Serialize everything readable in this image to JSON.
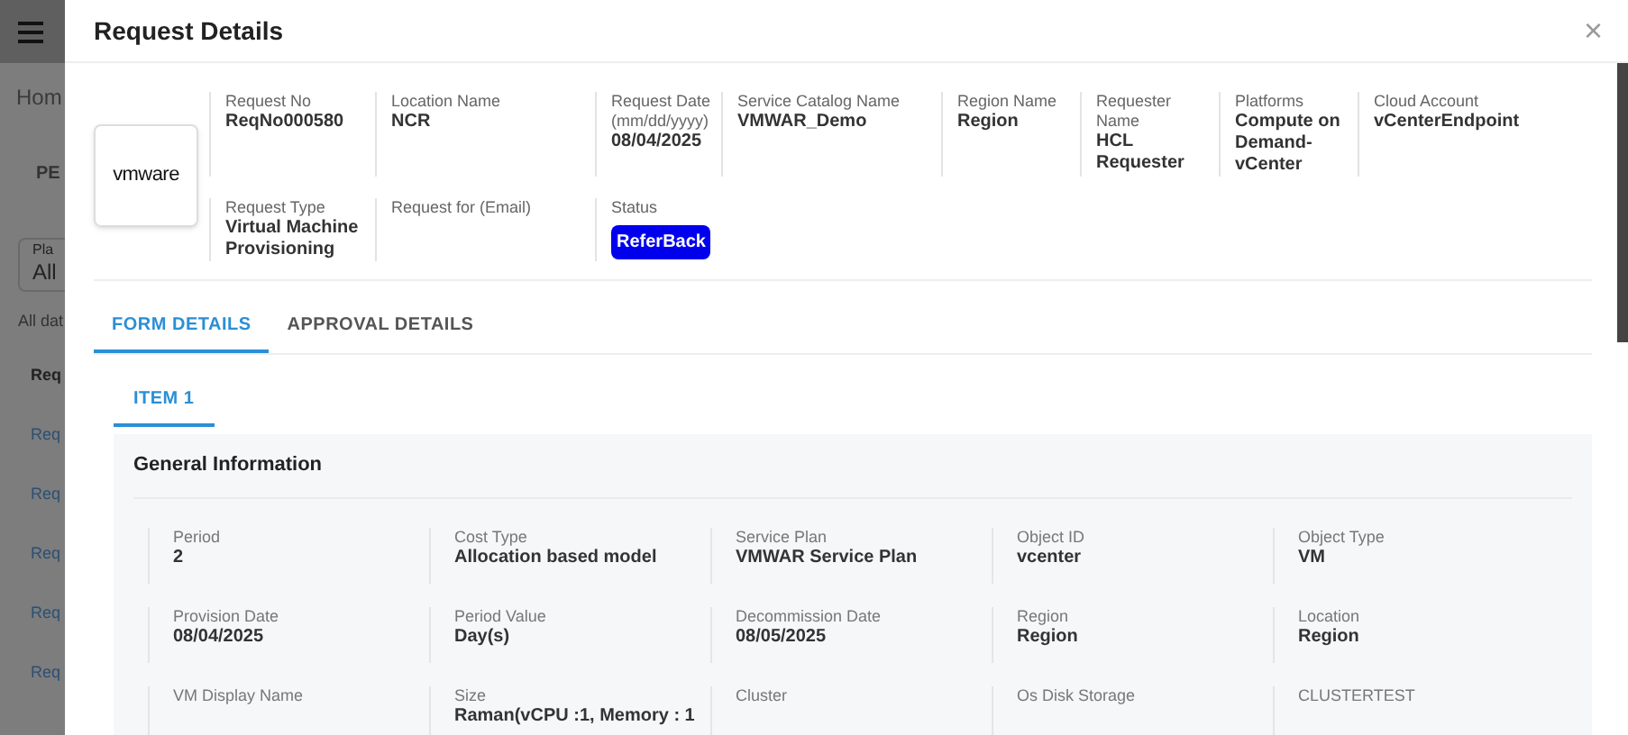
{
  "background": {
    "breadcrumb": "Hom",
    "tab": "PE",
    "filter": {
      "label": "Pla",
      "value": "All"
    },
    "caption": "All dat",
    "column_header": "Req",
    "rows": [
      "Req",
      "Req",
      "Req",
      "Req",
      "Req"
    ]
  },
  "dialog": {
    "title": "Request Details",
    "close": "×",
    "summary": {
      "logo": "vmware",
      "rows": [
        [
          {
            "label": "Request No",
            "value": "ReqNo000580"
          },
          {
            "label": "Location Name",
            "value": "NCR"
          },
          {
            "label": "Request Date (mm/dd/yyyy)",
            "value": "08/04/2025"
          },
          {
            "label": "Service Catalog Name",
            "value": "VMWAR_Demo"
          },
          {
            "label": "Region Name",
            "value": "Region"
          },
          {
            "label": "Requester Name",
            "value": "HCL Requester"
          },
          {
            "label": "Platforms",
            "value": "Compute on Demand-vCenter"
          },
          {
            "label": "Cloud Account",
            "value": "vCenterEndpoint"
          }
        ],
        [
          {
            "label": "Request Type",
            "value": "Virtual Machine Provisioning"
          },
          {
            "label": "Request for (Email)"
          },
          {
            "label": "Status",
            "badge": "ReferBack"
          }
        ]
      ]
    },
    "tabs": [
      {
        "label": "FORM DETAILS",
        "selected": true
      },
      {
        "label": "APPROVAL DETAILS",
        "selected": false
      }
    ],
    "item_tabs": [
      {
        "label": "ITEM 1",
        "selected": true
      }
    ],
    "section": {
      "title": "General Information",
      "fields": [
        {
          "label": "Period",
          "value": "2"
        },
        {
          "label": "Cost Type",
          "value": "Allocation based model"
        },
        {
          "label": "Service Plan",
          "value": "VMWAR Service Plan"
        },
        {
          "label": "Object ID",
          "value": "vcenter"
        },
        {
          "label": "Object Type",
          "value": "VM"
        },
        {
          "label": "Provision Date",
          "value": "08/04/2025"
        },
        {
          "label": "Period Value",
          "value": "Day(s)"
        },
        {
          "label": "Decommission Date",
          "value": "08/05/2025"
        },
        {
          "label": "Region",
          "value": "Region"
        },
        {
          "label": "Location",
          "value": "Region"
        },
        {
          "label": "VM Display Name"
        },
        {
          "label": "Size",
          "value": "Raman(vCPU :1, Memory : 1"
        },
        {
          "label": "Cluster"
        },
        {
          "label": "Os Disk Storage"
        },
        {
          "label": "CLUSTERTEST"
        }
      ]
    }
  }
}
